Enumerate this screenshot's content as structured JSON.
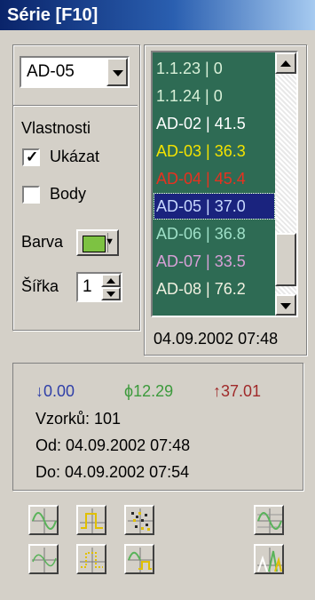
{
  "window": {
    "title": "Série [F10]"
  },
  "series_select": {
    "value": "AD-05"
  },
  "properties": {
    "heading": "Vlastnosti",
    "show_label": "Ukázat",
    "show_checked": true,
    "points_label": "Body",
    "points_checked": false,
    "color_label": "Barva",
    "color_value": "#7dc242",
    "width_label": "Šířka",
    "width_value": "1"
  },
  "series_list": {
    "items": [
      {
        "text": "1.1.23 | 0",
        "color": "#d8f0d8"
      },
      {
        "text": "1.1.24 | 0",
        "color": "#d8f0d8"
      },
      {
        "text": "AD-02 | 41.5",
        "color": "#ffffff"
      },
      {
        "text": "AD-03 | 36.3",
        "color": "#f4e300"
      },
      {
        "text": "AD-04 | 45.4",
        "color": "#e8311f"
      },
      {
        "text": "AD-05 | 37.0",
        "color": "#c8d8ff"
      },
      {
        "text": "AD-06 | 36.8",
        "color": "#9fe0c8"
      },
      {
        "text": "AD-07 | 33.5",
        "color": "#d7a0d7"
      },
      {
        "text": "AD-08 | 76.2",
        "color": "#f0f0e0"
      }
    ],
    "selected_index": 5
  },
  "current_time": "04.09.2002 07:48",
  "stats": {
    "min": "↓0.00",
    "min_color": "#2f3fa8",
    "avg": "ϕ12.29",
    "avg_color": "#3c9a3c",
    "max": "↑37.01",
    "max_color": "#a02a2a",
    "samples": "Vzorků: 101",
    "from": "Od: 04.09.2002 07:48",
    "to": "Do: 04.09.2002 07:54"
  },
  "toolbar": {
    "icons": [
      "sine-wave-icon",
      "step-wave-icon",
      "scatter-points-icon",
      "sine-grid-icon",
      "sine-axis-icon",
      "dotted-step-icon",
      "sine-step-icon",
      "mountain-graph-icon"
    ]
  }
}
